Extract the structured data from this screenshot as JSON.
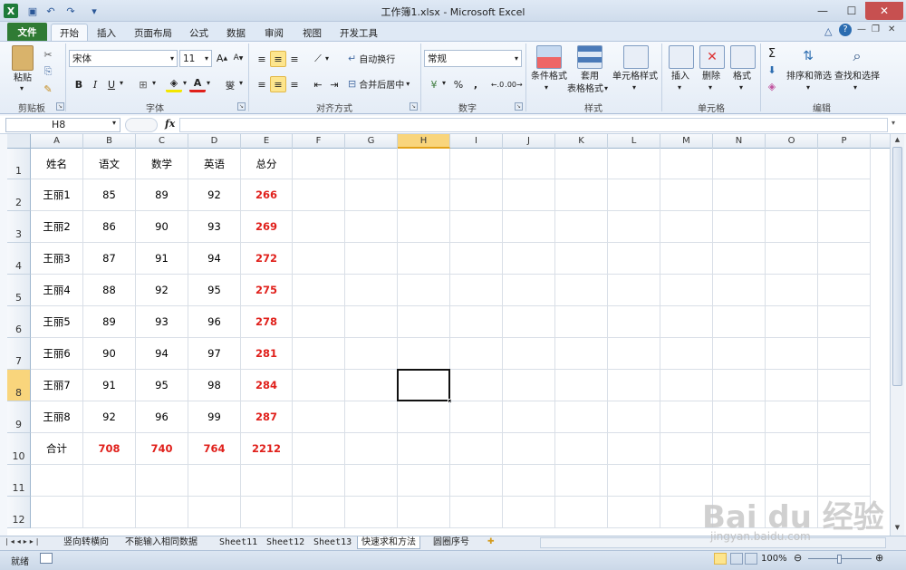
{
  "window": {
    "title": "工作簿1.xlsx - Microsoft Excel"
  },
  "ribbon_tabs": [
    "文件",
    "开始",
    "插入",
    "页面布局",
    "公式",
    "数据",
    "审阅",
    "视图",
    "开发工具"
  ],
  "ribbon": {
    "clipboard": {
      "paste": "粘贴",
      "group": "剪贴板"
    },
    "font": {
      "name": "宋体",
      "size": "11",
      "group": "字体",
      "bold": "B",
      "italic": "I",
      "underline": "U",
      "phonetic": "燮"
    },
    "alignment": {
      "wrap": "自动换行",
      "merge": "合并后居中",
      "group": "对齐方式"
    },
    "number": {
      "format": "常规",
      "percent": "%",
      "comma": ",",
      "group": "数字"
    },
    "styles": {
      "conditional": "条件格式",
      "table_1": "套用",
      "table_2": "表格格式",
      "cell_styles": "单元格样式",
      "group": "样式"
    },
    "cells": {
      "insert": "插入",
      "delete": "删除",
      "format": "格式",
      "group": "单元格"
    },
    "editing": {
      "sigma": "Σ",
      "sort": "排序和筛选",
      "find": "查找和选择",
      "group": "编辑"
    }
  },
  "formula_bar": {
    "name_box": "H8",
    "fx": "fx",
    "formula": ""
  },
  "columns": [
    "A",
    "B",
    "C",
    "D",
    "E",
    "F",
    "G",
    "H",
    "I",
    "J",
    "K",
    "L",
    "M",
    "N",
    "O",
    "P"
  ],
  "active_cell": {
    "column": "H",
    "row": "8"
  },
  "rows": [
    {
      "n": "1",
      "cells": [
        "姓名",
        "语文",
        "数学",
        "英语",
        "总分"
      ]
    },
    {
      "n": "2",
      "cells": [
        "王丽1",
        "85",
        "89",
        "92",
        "266"
      ]
    },
    {
      "n": "3",
      "cells": [
        "王丽2",
        "86",
        "90",
        "93",
        "269"
      ]
    },
    {
      "n": "4",
      "cells": [
        "王丽3",
        "87",
        "91",
        "94",
        "272"
      ]
    },
    {
      "n": "5",
      "cells": [
        "王丽4",
        "88",
        "92",
        "95",
        "275"
      ]
    },
    {
      "n": "6",
      "cells": [
        "王丽5",
        "89",
        "93",
        "96",
        "278"
      ]
    },
    {
      "n": "7",
      "cells": [
        "王丽6",
        "90",
        "94",
        "97",
        "281"
      ]
    },
    {
      "n": "8",
      "cells": [
        "王丽7",
        "91",
        "95",
        "98",
        "284"
      ]
    },
    {
      "n": "9",
      "cells": [
        "王丽8",
        "92",
        "96",
        "99",
        "287"
      ]
    },
    {
      "n": "10",
      "cells": [
        "合计",
        "708",
        "740",
        "764",
        "2212"
      ]
    },
    {
      "n": "11",
      "cells": [
        "",
        "",
        "",
        "",
        ""
      ]
    },
    {
      "n": "12",
      "cells": [
        "",
        "",
        "",
        "",
        ""
      ]
    }
  ],
  "highlight_color": "#e0201b",
  "sheet_tabs": [
    "竖向转横向",
    "不能输入相同数据",
    "Sheet11",
    "Sheet12",
    "Sheet13",
    "快速求和方法",
    "圆圈序号"
  ],
  "status": {
    "ready": "就绪",
    "zoom": "100%"
  },
  "watermark": {
    "brand": "Bai du 经验",
    "url": "jingyan.baidu.com"
  }
}
